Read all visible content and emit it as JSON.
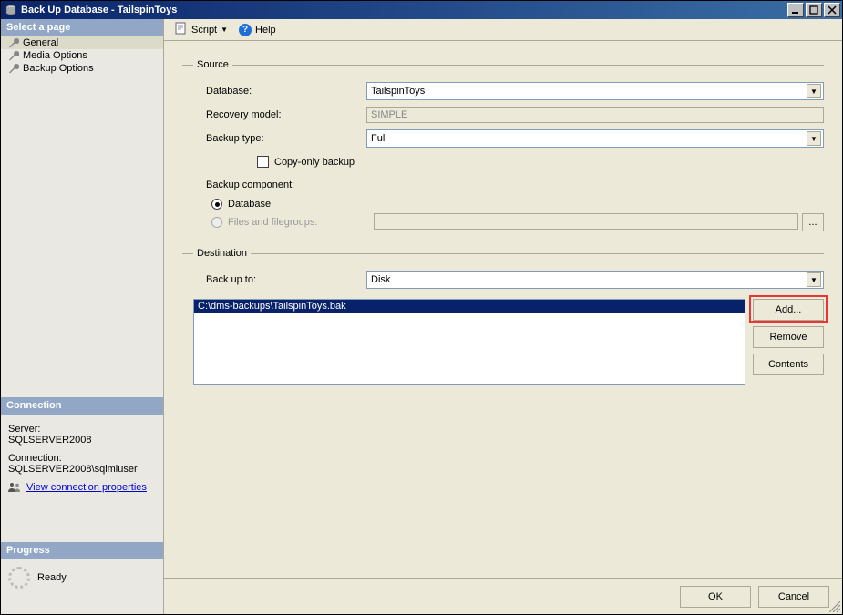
{
  "window": {
    "title": "Back Up Database - TailspinToys"
  },
  "sidebar": {
    "select_header": "Select a page",
    "pages": [
      {
        "label": "General",
        "selected": true
      },
      {
        "label": "Media Options",
        "selected": false
      },
      {
        "label": "Backup Options",
        "selected": false
      }
    ],
    "connection_header": "Connection",
    "server_label": "Server:",
    "server_value": "SQLSERVER2008",
    "connection_label": "Connection:",
    "connection_value": "SQLSERVER2008\\sqlmiuser",
    "view_conn_props": "View connection properties",
    "progress_header": "Progress",
    "progress_status": "Ready"
  },
  "toolbar": {
    "script": "Script",
    "help": "Help"
  },
  "source": {
    "legend": "Source",
    "database_label": "Database:",
    "database_value": "TailspinToys",
    "recovery_label": "Recovery model:",
    "recovery_value": "SIMPLE",
    "backup_type_label": "Backup type:",
    "backup_type_value": "Full",
    "copy_only_label": "Copy-only backup",
    "component_label": "Backup component:",
    "radio_database": "Database",
    "radio_files": "Files and filegroups:"
  },
  "destination": {
    "legend": "Destination",
    "backup_to_label": "Back up to:",
    "backup_to_value": "Disk",
    "paths": [
      "C:\\dms-backups\\TailspinToys.bak"
    ],
    "add_btn": "Add...",
    "remove_btn": "Remove",
    "contents_btn": "Contents"
  },
  "footer": {
    "ok": "OK",
    "cancel": "Cancel"
  }
}
